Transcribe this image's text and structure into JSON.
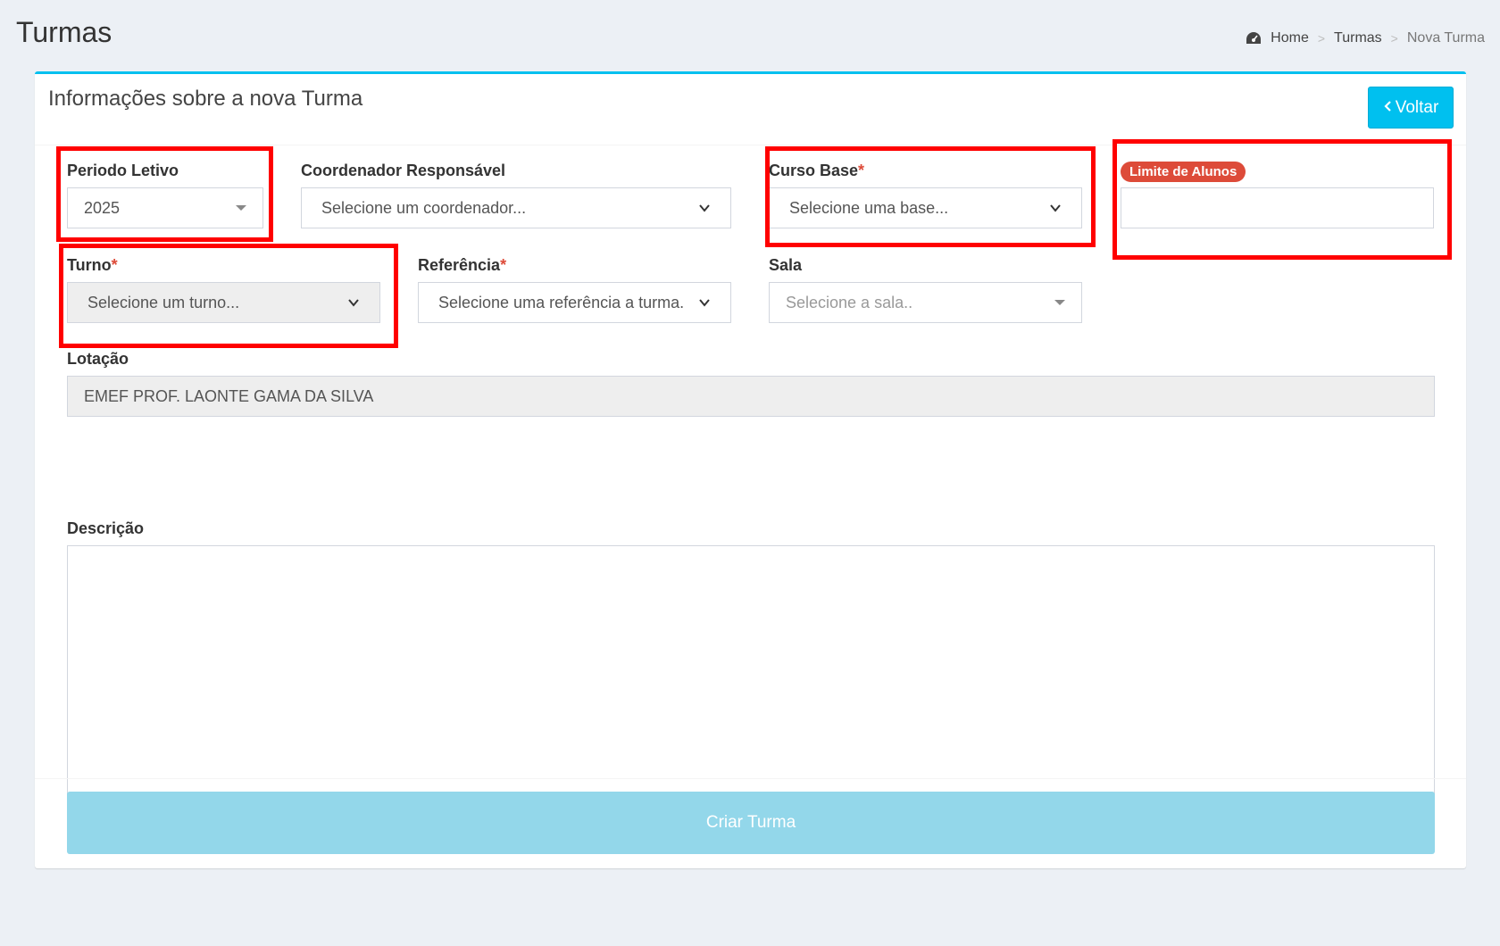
{
  "page": {
    "title": "Turmas"
  },
  "breadcrumb": {
    "home": "Home",
    "section": "Turmas",
    "current": "Nova Turma"
  },
  "panel": {
    "title": "Informações sobre a nova Turma",
    "back_label": "Voltar"
  },
  "form": {
    "periodo": {
      "label": "Periodo Letivo",
      "value": "2025"
    },
    "coordenador": {
      "label": "Coordenador Responsável",
      "value": "Selecione um coordenador..."
    },
    "curso": {
      "label": "Curso Base",
      "required": "*",
      "value": "Selecione uma base..."
    },
    "limite": {
      "label": "Limite de Alunos",
      "value": ""
    },
    "turno": {
      "label": "Turno",
      "required": "*",
      "value": "Selecione um turno..."
    },
    "referencia": {
      "label": "Referência",
      "required": "*",
      "value": "Selecione uma referência a turma."
    },
    "sala": {
      "label": "Sala",
      "placeholder": "Selecione a sala.."
    },
    "lotacao": {
      "label": "Lotação",
      "value": "EMEF PROF. LAONTE GAMA DA SILVA"
    },
    "descricao": {
      "label": "Descrição",
      "value": ""
    }
  },
  "submit": {
    "label": "Criar Turma"
  },
  "colors": {
    "accent": "#00c0ef",
    "required": "#dd4b39",
    "highlight": "#ff0000",
    "submit_disabled": "#93d7ea"
  }
}
